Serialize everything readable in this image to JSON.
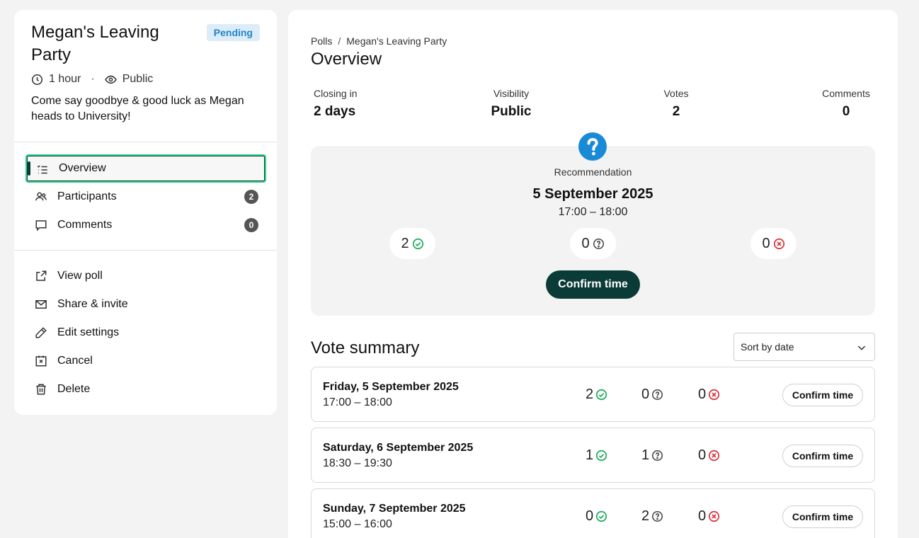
{
  "poll": {
    "title": "Megan's Leaving Party",
    "status": "Pending",
    "duration": "1 hour",
    "meta_separator": "·",
    "visibility": "Public",
    "description": "Come say goodbye & good luck as Megan heads to University!"
  },
  "nav": [
    {
      "label": "Overview",
      "icon": "list-icon",
      "active": true
    },
    {
      "label": "Participants",
      "icon": "users-icon",
      "count": "2"
    },
    {
      "label": "Comments",
      "icon": "comment-icon",
      "count": "0"
    }
  ],
  "actions": [
    {
      "label": "View poll",
      "icon": "external-link-icon"
    },
    {
      "label": "Share & invite",
      "icon": "mail-icon"
    },
    {
      "label": "Edit settings",
      "icon": "pencil-icon"
    },
    {
      "label": "Cancel",
      "icon": "cancel-calendar-icon"
    },
    {
      "label": "Delete",
      "icon": "trash-icon"
    }
  ],
  "breadcrumb": {
    "root": "Polls",
    "separator": "/",
    "current": "Megan's Leaving Party"
  },
  "page_title": "Overview",
  "stats": [
    {
      "label": "Closing in",
      "value": "2 days"
    },
    {
      "label": "Visibility",
      "value": "Public"
    },
    {
      "label": "Votes",
      "value": "2"
    },
    {
      "label": "Comments",
      "value": "0"
    }
  ],
  "recommendation": {
    "label": "Recommendation",
    "date": "5 September 2025",
    "time": "17:00 – 18:00",
    "yes": "2",
    "maybe": "0",
    "no": "0",
    "confirm_label": "Confirm time"
  },
  "vote_summary": {
    "title": "Vote summary",
    "sort_label": "Sort by date",
    "confirm_label": "Confirm time",
    "rows": [
      {
        "day": "Friday, 5 September 2025",
        "time": "17:00 – 18:00",
        "yes": "2",
        "maybe": "0",
        "no": "0"
      },
      {
        "day": "Saturday, 6 September 2025",
        "time": "18:30 – 19:30",
        "yes": "1",
        "maybe": "1",
        "no": "0"
      },
      {
        "day": "Sunday, 7 September 2025",
        "time": "15:00 – 16:00",
        "yes": "0",
        "maybe": "2",
        "no": "0"
      }
    ]
  },
  "colors": {
    "accent_dark": "#0b3b37",
    "yes_green": "#1aaa5a",
    "no_red": "#d9323c",
    "info_blue": "#1a8ad6",
    "pending_bg": "#dcecf8"
  }
}
